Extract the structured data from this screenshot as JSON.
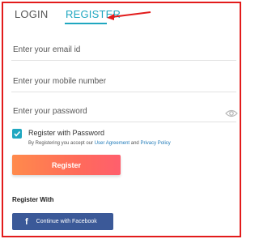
{
  "tabs": {
    "login_label": "LOGIN",
    "register_label": "REGISTER"
  },
  "form": {
    "email_placeholder": "Enter your email id",
    "mobile_placeholder": "Enter your mobile number",
    "password_placeholder": "Enter your password",
    "register_with_password_label": "Register with Password",
    "register_with_password_checked": true,
    "agreement_prefix": "By Registering you accept our ",
    "agreement_link": "User Agreement",
    "agreement_and": " and ",
    "privacy_link": "Privacy Policy",
    "submit_label": "Register"
  },
  "social": {
    "heading": "Register With",
    "facebook_label": "Continue with Facebook",
    "facebook_icon": "f"
  },
  "icons": {
    "password_toggle": "eye-icon",
    "facebook": "facebook-icon",
    "annotation": "red-arrow-icon"
  },
  "colors": {
    "accent": "#1fa7c0",
    "annotation": "#e21b1b",
    "facebook": "#3b5998",
    "button_gradient_start": "#ff8a4c",
    "button_gradient_end": "#ff5f6d"
  }
}
